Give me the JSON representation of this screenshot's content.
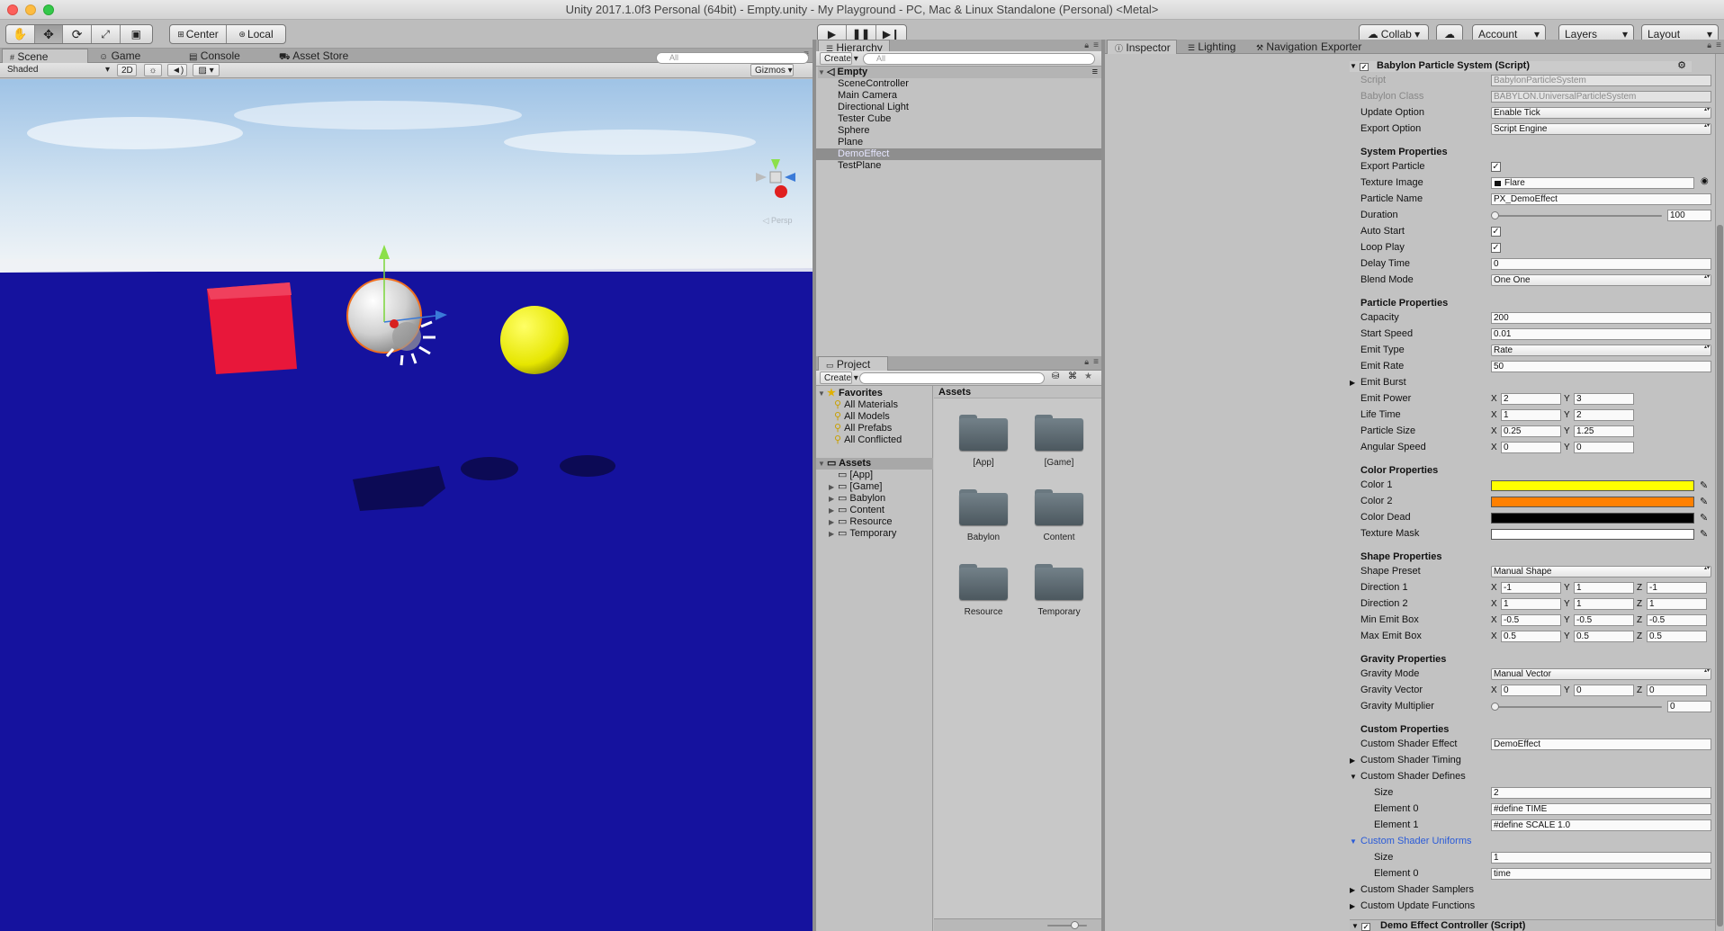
{
  "window": {
    "title": "Unity 2017.1.0f3 Personal (64bit) - Empty.unity - My Playground - PC, Mac & Linux Standalone (Personal) <Metal>"
  },
  "toolbar": {
    "pivot": "Center",
    "space": "Local",
    "collab": "Collab",
    "account": "Account",
    "layers": "Layers",
    "layout": "Layout"
  },
  "scene_tabs": [
    "Scene",
    "Game",
    "Console",
    "Asset Store"
  ],
  "scene_bar": {
    "shading": "Shaded",
    "mode2d": "2D",
    "gizmos": "Gizmos",
    "search_placeholder": "All"
  },
  "gizmo_label": "Persp",
  "hierarchy": {
    "tab": "Hierarchy",
    "create": "Create",
    "search_placeholder": "All",
    "scene_name": "Empty",
    "items": [
      "SceneController",
      "Main Camera",
      "Directional Light",
      "Tester Cube",
      "Sphere",
      "Plane",
      "DemoEffect",
      "TestPlane"
    ],
    "selected": "DemoEffect"
  },
  "project": {
    "tab": "Project",
    "create": "Create",
    "favorites_label": "Favorites",
    "favorites": [
      "All Materials",
      "All Models",
      "All Prefabs",
      "All Conflicted"
    ],
    "assets_label": "Assets",
    "folders": [
      "[App]",
      "[Game]",
      "Babylon",
      "Content",
      "Resource",
      "Temporary"
    ],
    "grid_title": "Assets"
  },
  "inspector": {
    "tabs": [
      "Inspector",
      "Lighting",
      "Navigation",
      "Exporter"
    ],
    "component_title": "Babylon Particle System (Script)",
    "script_label": "Script",
    "script_value": "BabylonParticleSystem",
    "class_label": "Babylon Class",
    "class_value": "BABYLON.UniversalParticleSystem",
    "update_label": "Update Option",
    "update_value": "Enable Tick",
    "export_label": "Export Option",
    "export_value": "Script Engine",
    "system_header": "System Properties",
    "export_particle": "Export Particle",
    "texture_label": "Texture Image",
    "texture_value": "Flare",
    "name_label": "Particle Name",
    "name_value": "PX_DemoEffect",
    "duration_label": "Duration",
    "duration_value": "100",
    "autostart_label": "Auto Start",
    "loop_label": "Loop Play",
    "delay_label": "Delay Time",
    "delay_value": "0",
    "blend_label": "Blend Mode",
    "blend_value": "One One",
    "particle_header": "Particle Properties",
    "capacity_label": "Capacity",
    "capacity_value": "200",
    "speed_label": "Start Speed",
    "speed_value": "0.01",
    "emittype_label": "Emit Type",
    "emittype_value": "Rate",
    "emitrate_label": "Emit Rate",
    "emitrate_value": "50",
    "burst_label": "Emit Burst",
    "power_label": "Emit Power",
    "power_x": "2",
    "power_y": "3",
    "life_label": "Life Time",
    "life_x": "1",
    "life_y": "2",
    "size_label": "Particle Size",
    "size_x": "0.25",
    "size_y": "1.25",
    "angular_label": "Angular Speed",
    "angular_x": "0",
    "angular_y": "0",
    "color_header": "Color Properties",
    "color1_label": "Color 1",
    "color1": "#ffff00",
    "color2_label": "Color 2",
    "color2": "#ff8000",
    "colordead_label": "Color Dead",
    "colordead": "#000000",
    "mask_label": "Texture Mask",
    "mask": "#ffffff",
    "shape_header": "Shape Properties",
    "preset_label": "Shape Preset",
    "preset_value": "Manual Shape",
    "dir1_label": "Direction 1",
    "dir1_x": "-1",
    "dir1_y": "1",
    "dir1_z": "-1",
    "dir2_label": "Direction 2",
    "dir2_x": "1",
    "dir2_y": "1",
    "dir2_z": "1",
    "minbox_label": "Min Emit Box",
    "minbox_x": "-0.5",
    "minbox_y": "-0.5",
    "minbox_z": "-0.5",
    "maxbox_label": "Max Emit Box",
    "maxbox_x": "0.5",
    "maxbox_y": "0.5",
    "maxbox_z": "0.5",
    "gravity_header": "Gravity Properties",
    "gmode_label": "Gravity Mode",
    "gmode_value": "Manual Vector",
    "gvec_label": "Gravity Vector",
    "gvec_x": "0",
    "gvec_y": "0",
    "gvec_z": "0",
    "gmult_label": "Gravity Multiplier",
    "gmult_value": "0",
    "custom_header": "Custom Properties",
    "cse_label": "Custom Shader Effect",
    "cse_value": "DemoEffect",
    "cst_label": "Custom Shader Timing",
    "csd_label": "Custom Shader Defines",
    "csd_size_label": "Size",
    "csd_size": "2",
    "csd_e0_label": "Element 0",
    "csd_e0": "#define TIME",
    "csd_e1_label": "Element 1",
    "csd_e1": "#define SCALE 1.0",
    "csu_label": "Custom Shader Uniforms",
    "csu_size_label": "Size",
    "csu_size": "1",
    "csu_e0_label": "Element 0",
    "csu_e0": "time",
    "css_label": "Custom Shader Samplers",
    "cuf_label": "Custom Update Functions",
    "next_component": "Demo Effect Controller (Script)"
  }
}
